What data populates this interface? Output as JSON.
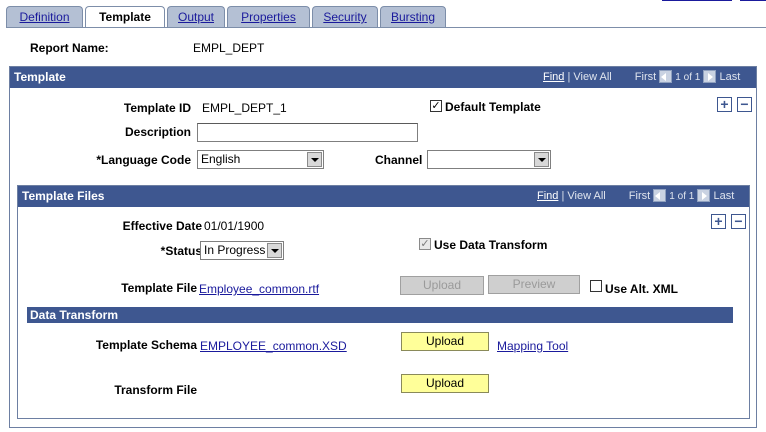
{
  "tabs": [
    {
      "label": "Definition"
    },
    {
      "label": "Template"
    },
    {
      "label": "Output"
    },
    {
      "label": "Properties"
    },
    {
      "label": "Security"
    },
    {
      "label": "Bursting"
    }
  ],
  "report": {
    "label": "Report Name:",
    "value": "EMPL_DEPT"
  },
  "template_section": {
    "title": "Template",
    "nav": {
      "find": "Find",
      "view_all": "View All",
      "first": "First",
      "count": "1 of 1",
      "last": "Last"
    },
    "template_id": {
      "label": "Template ID",
      "value": "EMPL_DEPT_1"
    },
    "default_template": {
      "label": "Default Template",
      "checked": true
    },
    "description": {
      "label": "Description",
      "value": ""
    },
    "language_code": {
      "label": "*Language Code",
      "value": "English"
    },
    "channel": {
      "label": "Channel",
      "value": ""
    }
  },
  "files_section": {
    "title": "Template Files",
    "nav": {
      "find": "Find",
      "view_all": "View All",
      "first": "First",
      "count": "1 of 1",
      "last": "Last"
    },
    "effective_date": {
      "label": "Effective Date",
      "value": "01/01/1900"
    },
    "status": {
      "label": "*Status",
      "value": "In Progress"
    },
    "use_data_transform": {
      "label": "Use Data Transform",
      "checked": true
    },
    "template_file": {
      "label": "Template File",
      "value": "Employee_common.rtf"
    },
    "upload_label": "Upload",
    "preview_label": "Preview",
    "use_alt_xml": {
      "label": "Use Alt. XML",
      "checked": false
    }
  },
  "data_transform": {
    "title": "Data Transform",
    "template_schema": {
      "label": "Template Schema",
      "value": "EMPLOYEE_common.XSD"
    },
    "upload_label": "Upload",
    "mapping_tool": "Mapping Tool",
    "transform_file": {
      "label": "Transform File"
    },
    "transform_upload_label": "Upload"
  },
  "icons": {
    "add": "+",
    "delete": "−",
    "checkmark": "✓"
  }
}
